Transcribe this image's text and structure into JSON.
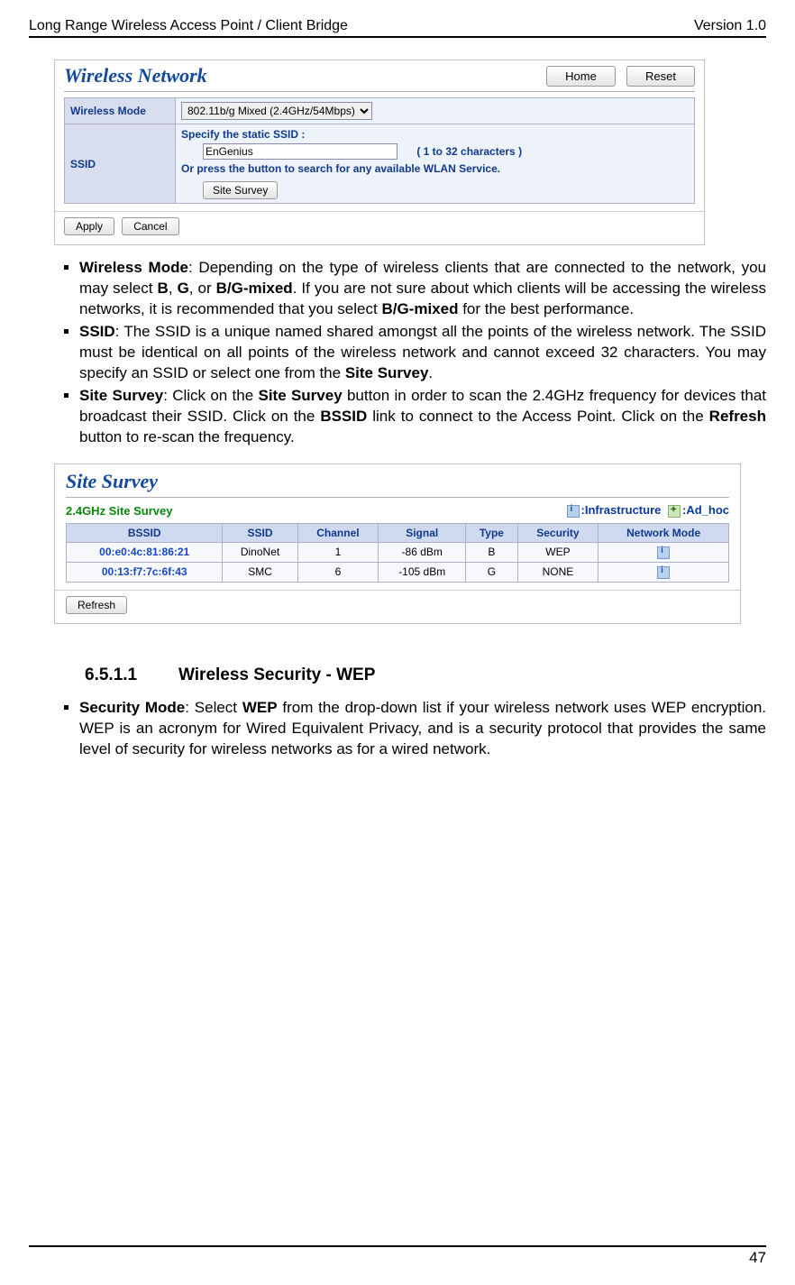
{
  "header": {
    "left": "Long Range Wireless Access Point / Client Bridge",
    "right": "Version 1.0"
  },
  "wireless_panel": {
    "title": "Wireless Network",
    "home_btn": "Home",
    "reset_btn": "Reset",
    "mode_label": "Wireless Mode",
    "mode_value": "802.11b/g Mixed (2.4GHz/54Mbps)",
    "ssid_label": "SSID",
    "ssid_line1": "Specify the static SSID  :",
    "ssid_input": "EnGenius",
    "ssid_chars": "( 1 to 32 characters )",
    "ssid_line2": "Or press the button to search for any available WLAN Service.",
    "site_survey_btn": "Site Survey",
    "apply_btn": "Apply",
    "cancel_btn": "Cancel"
  },
  "bullets1": {
    "b1": {
      "pre": "Wireless Mode",
      "mid": ": Depending on the type of wireless clients that are connected to the network, you may select ",
      "b": "B",
      "g": "G",
      "bg": "B/G-mixed",
      "mid2": ". If you are not sure about which clients will be accessing the wireless networks, it is recommended that you select ",
      "bg2": "B/G-mixed",
      "post": " for the best performance."
    },
    "b2": {
      "pre": "SSID",
      "mid": ": The SSID is a unique named shared amongst all the points of the wireless network. The SSID must be identical on all points of the wireless network and cannot exceed 32 characters. You may specify an SSID or select one from the ",
      "ss": "Site Survey",
      "post": "."
    },
    "b3": {
      "pre": "Site Survey",
      "mid": ": Click on the ",
      "ss": "Site Survey",
      "mid2": " button in order to scan the 2.4GHz frequency for devices that broadcast their SSID. Click on the ",
      "bssid": "BSSID",
      "mid3": " link to connect to the Access Point. Click on the ",
      "refresh": "Refresh",
      "post": " button to re-scan the frequency."
    }
  },
  "site_panel": {
    "title": "Site Survey",
    "legend_left": "2.4GHz Site Survey",
    "legend_infra": ":Infrastructure",
    "legend_adhoc": ":Ad_hoc",
    "cols": [
      "BSSID",
      "SSID",
      "Channel",
      "Signal",
      "Type",
      "Security",
      "Network Mode"
    ],
    "rows": [
      {
        "bssid": "00:e0:4c:81:86:21",
        "ssid": "DinoNet",
        "channel": "1",
        "signal": "-86 dBm",
        "type": "B",
        "security": "WEP",
        "mode": "infra"
      },
      {
        "bssid": "00:13:f7:7c:6f:43",
        "ssid": "SMC",
        "channel": "6",
        "signal": "-105 dBm",
        "type": "G",
        "security": "NONE",
        "mode": "infra"
      }
    ],
    "refresh_btn": "Refresh"
  },
  "section": {
    "num": "6.5.1.1",
    "title": "Wireless Security - WEP"
  },
  "bullets2": {
    "b1": {
      "pre": "Security Mode",
      "mid": ": Select ",
      "wep": "WEP",
      "post": " from the drop-down list if your wireless network uses WEP encryption. WEP is an acronym for Wired Equivalent Privacy, and is a security protocol that provides the same level of security for wireless networks as for a wired network."
    }
  },
  "footer": {
    "page": "47"
  }
}
